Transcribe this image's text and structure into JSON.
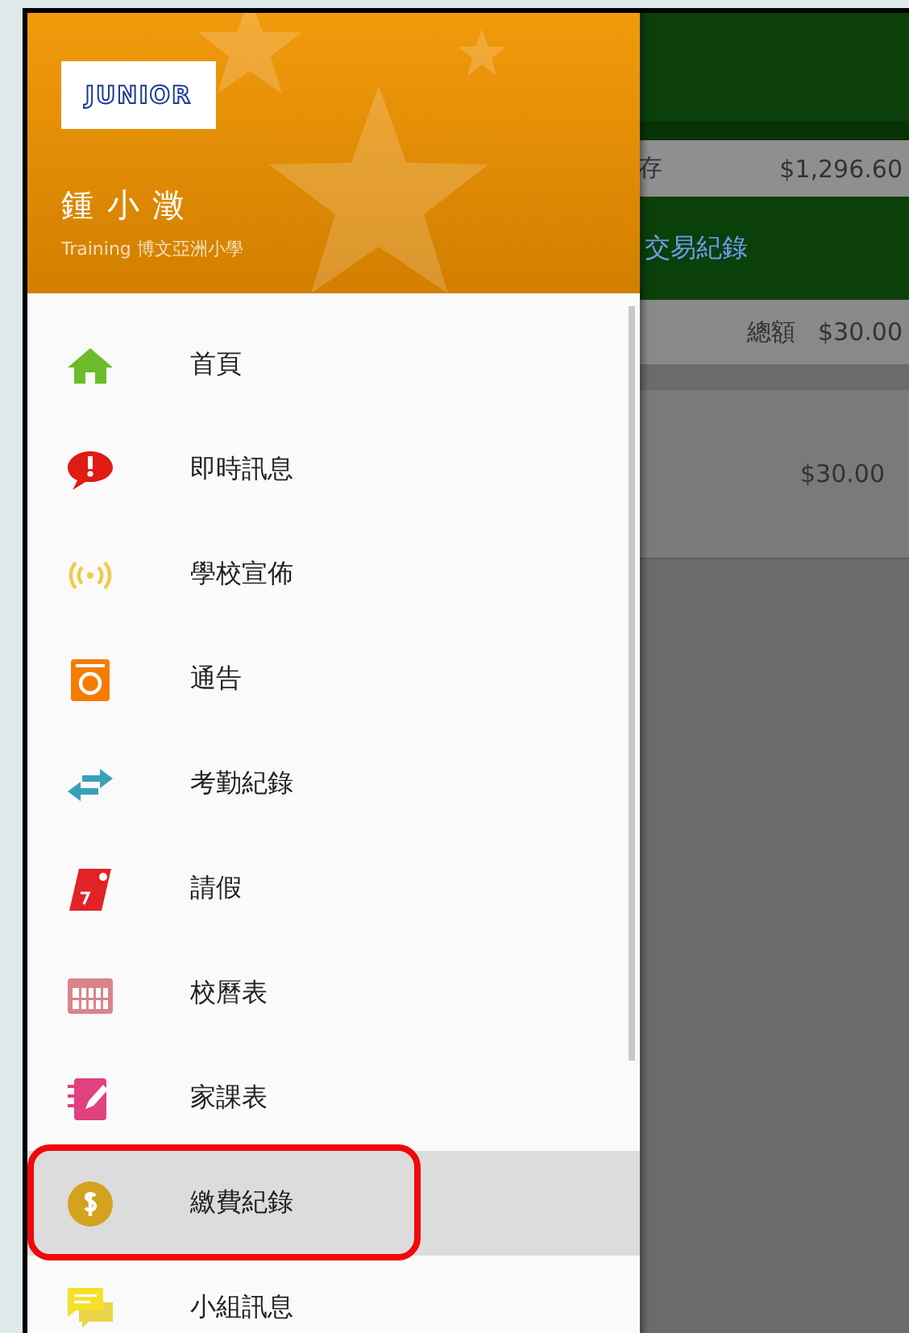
{
  "drawer": {
    "logo": {
      "text": "JUNIOR"
    },
    "user": {
      "name": "鍾 小 澂",
      "school": "Training 博文亞洲小學"
    },
    "items": [
      {
        "label": "首頁",
        "kind": "home",
        "selected": false,
        "annotated": false
      },
      {
        "label": "即時訊息",
        "kind": "message",
        "selected": false,
        "annotated": false
      },
      {
        "label": "學校宣佈",
        "kind": "broadcast",
        "selected": false,
        "annotated": false
      },
      {
        "label": "通告",
        "kind": "notice",
        "selected": false,
        "annotated": false
      },
      {
        "label": "考勤紀錄",
        "kind": "attendance",
        "selected": false,
        "annotated": false
      },
      {
        "label": "請假",
        "kind": "leave",
        "selected": false,
        "annotated": false
      },
      {
        "label": "校曆表",
        "kind": "calendar",
        "selected": false,
        "annotated": false
      },
      {
        "label": "家課表",
        "kind": "homework",
        "selected": false,
        "annotated": false
      },
      {
        "label": "繳費紀錄",
        "kind": "payment",
        "selected": true,
        "annotated": true
      },
      {
        "label": "小組訊息",
        "kind": "group",
        "selected": false,
        "annotated": false
      }
    ]
  },
  "background": {
    "balance": {
      "label": "存",
      "value": "$1,296.60"
    },
    "section_title": "交易紀錄",
    "total": {
      "label": "總額",
      "value": "$30.00"
    },
    "record": {
      "value": "$30.00"
    }
  }
}
